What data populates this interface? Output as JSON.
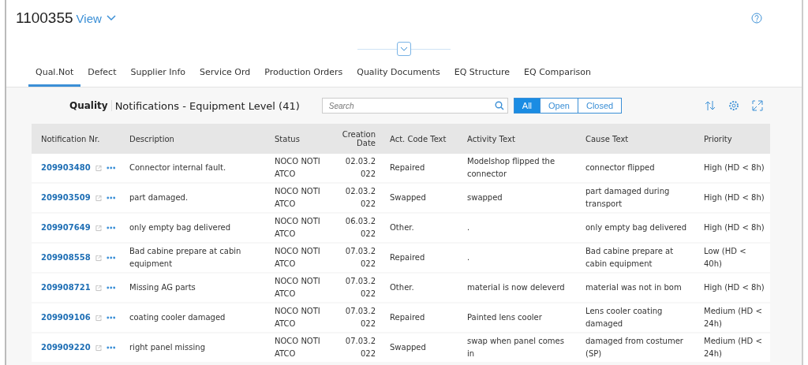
{
  "header": {
    "title": "1100355",
    "view_label": "View"
  },
  "tabs": [
    {
      "label": "Qual.Not",
      "selected": true
    },
    {
      "label": "Defect",
      "selected": false
    },
    {
      "label": "Supplier Info",
      "selected": false
    },
    {
      "label": "Service Ord",
      "selected": false
    },
    {
      "label": "Production Orders",
      "selected": false
    },
    {
      "label": "Quality Documents",
      "selected": false
    },
    {
      "label": "EQ Structure",
      "selected": false
    },
    {
      "label": "EQ Comparison",
      "selected": false
    }
  ],
  "toolbar": {
    "title_bold": "Quality",
    "title": "Notifications - Equipment Level (41)",
    "search": {
      "placeholder": "Search"
    },
    "filters": [
      {
        "label": "All",
        "selected": true
      },
      {
        "label": "Open",
        "selected": false
      },
      {
        "label": "Closed",
        "selected": false
      }
    ]
  },
  "table": {
    "columns": [
      "Notification Nr.",
      "Description",
      "Status",
      "Creation Date",
      "Act. Code Text",
      "Activity Text",
      "Cause Text",
      "Priority"
    ],
    "rows": [
      {
        "number": "209903480",
        "description": "Connector internal fault.",
        "status": "NOCO NOTI ATCO",
        "date": "02.03.2022",
        "act_code": "Repaired",
        "activity": "Modelshop flipped the connector",
        "cause": "connector flipped",
        "priority": "High (HD < 8h)"
      },
      {
        "number": "209903509",
        "description": "part damaged.",
        "status": "NOCO NOTI ATCO",
        "date": "02.03.2022",
        "act_code": "Swapped",
        "activity": "swapped",
        "cause": "part damaged during transport",
        "priority": "High (HD < 8h)"
      },
      {
        "number": "209907649",
        "description": "only empty bag delivered",
        "status": "NOCO NOTI ATCO",
        "date": "06.03.2022",
        "act_code": "Other.",
        "activity": ".",
        "cause": "only empty bag delivered",
        "priority": "High (HD < 8h)"
      },
      {
        "number": "209908558",
        "description": "Bad cabine prepare at cabin equipment",
        "status": "NOCO NOTI ATCO",
        "date": "07.03.2022",
        "act_code": "Repaired",
        "activity": ".",
        "cause": "Bad cabine prepare at cabin equipment",
        "priority": "Low (HD < 40h)"
      },
      {
        "number": "209908721",
        "description": "Missing AG parts",
        "status": "NOCO NOTI ATCO",
        "date": "07.03.2022",
        "act_code": "Other.",
        "activity": "material is now deleverd",
        "cause": "material was not in bom",
        "priority": "High (HD < 8h)"
      },
      {
        "number": "209909106",
        "description": "coating cooler damaged",
        "status": "NOCO NOTI ATCO",
        "date": "07.03.2022",
        "act_code": "Repaired",
        "activity": "Painted lens cooler",
        "cause": "Lens cooler coating damaged",
        "priority": "Medium (HD < 24h)"
      },
      {
        "number": "209909220",
        "description": "right panel missing",
        "status": "NOCO NOTI ATCO",
        "date": "07.03.2022",
        "act_code": "Swapped",
        "activity": "swap when panel comes in",
        "cause": "damaged from costumer (SP)",
        "priority": "Medium (HD < 24h)"
      }
    ]
  }
}
